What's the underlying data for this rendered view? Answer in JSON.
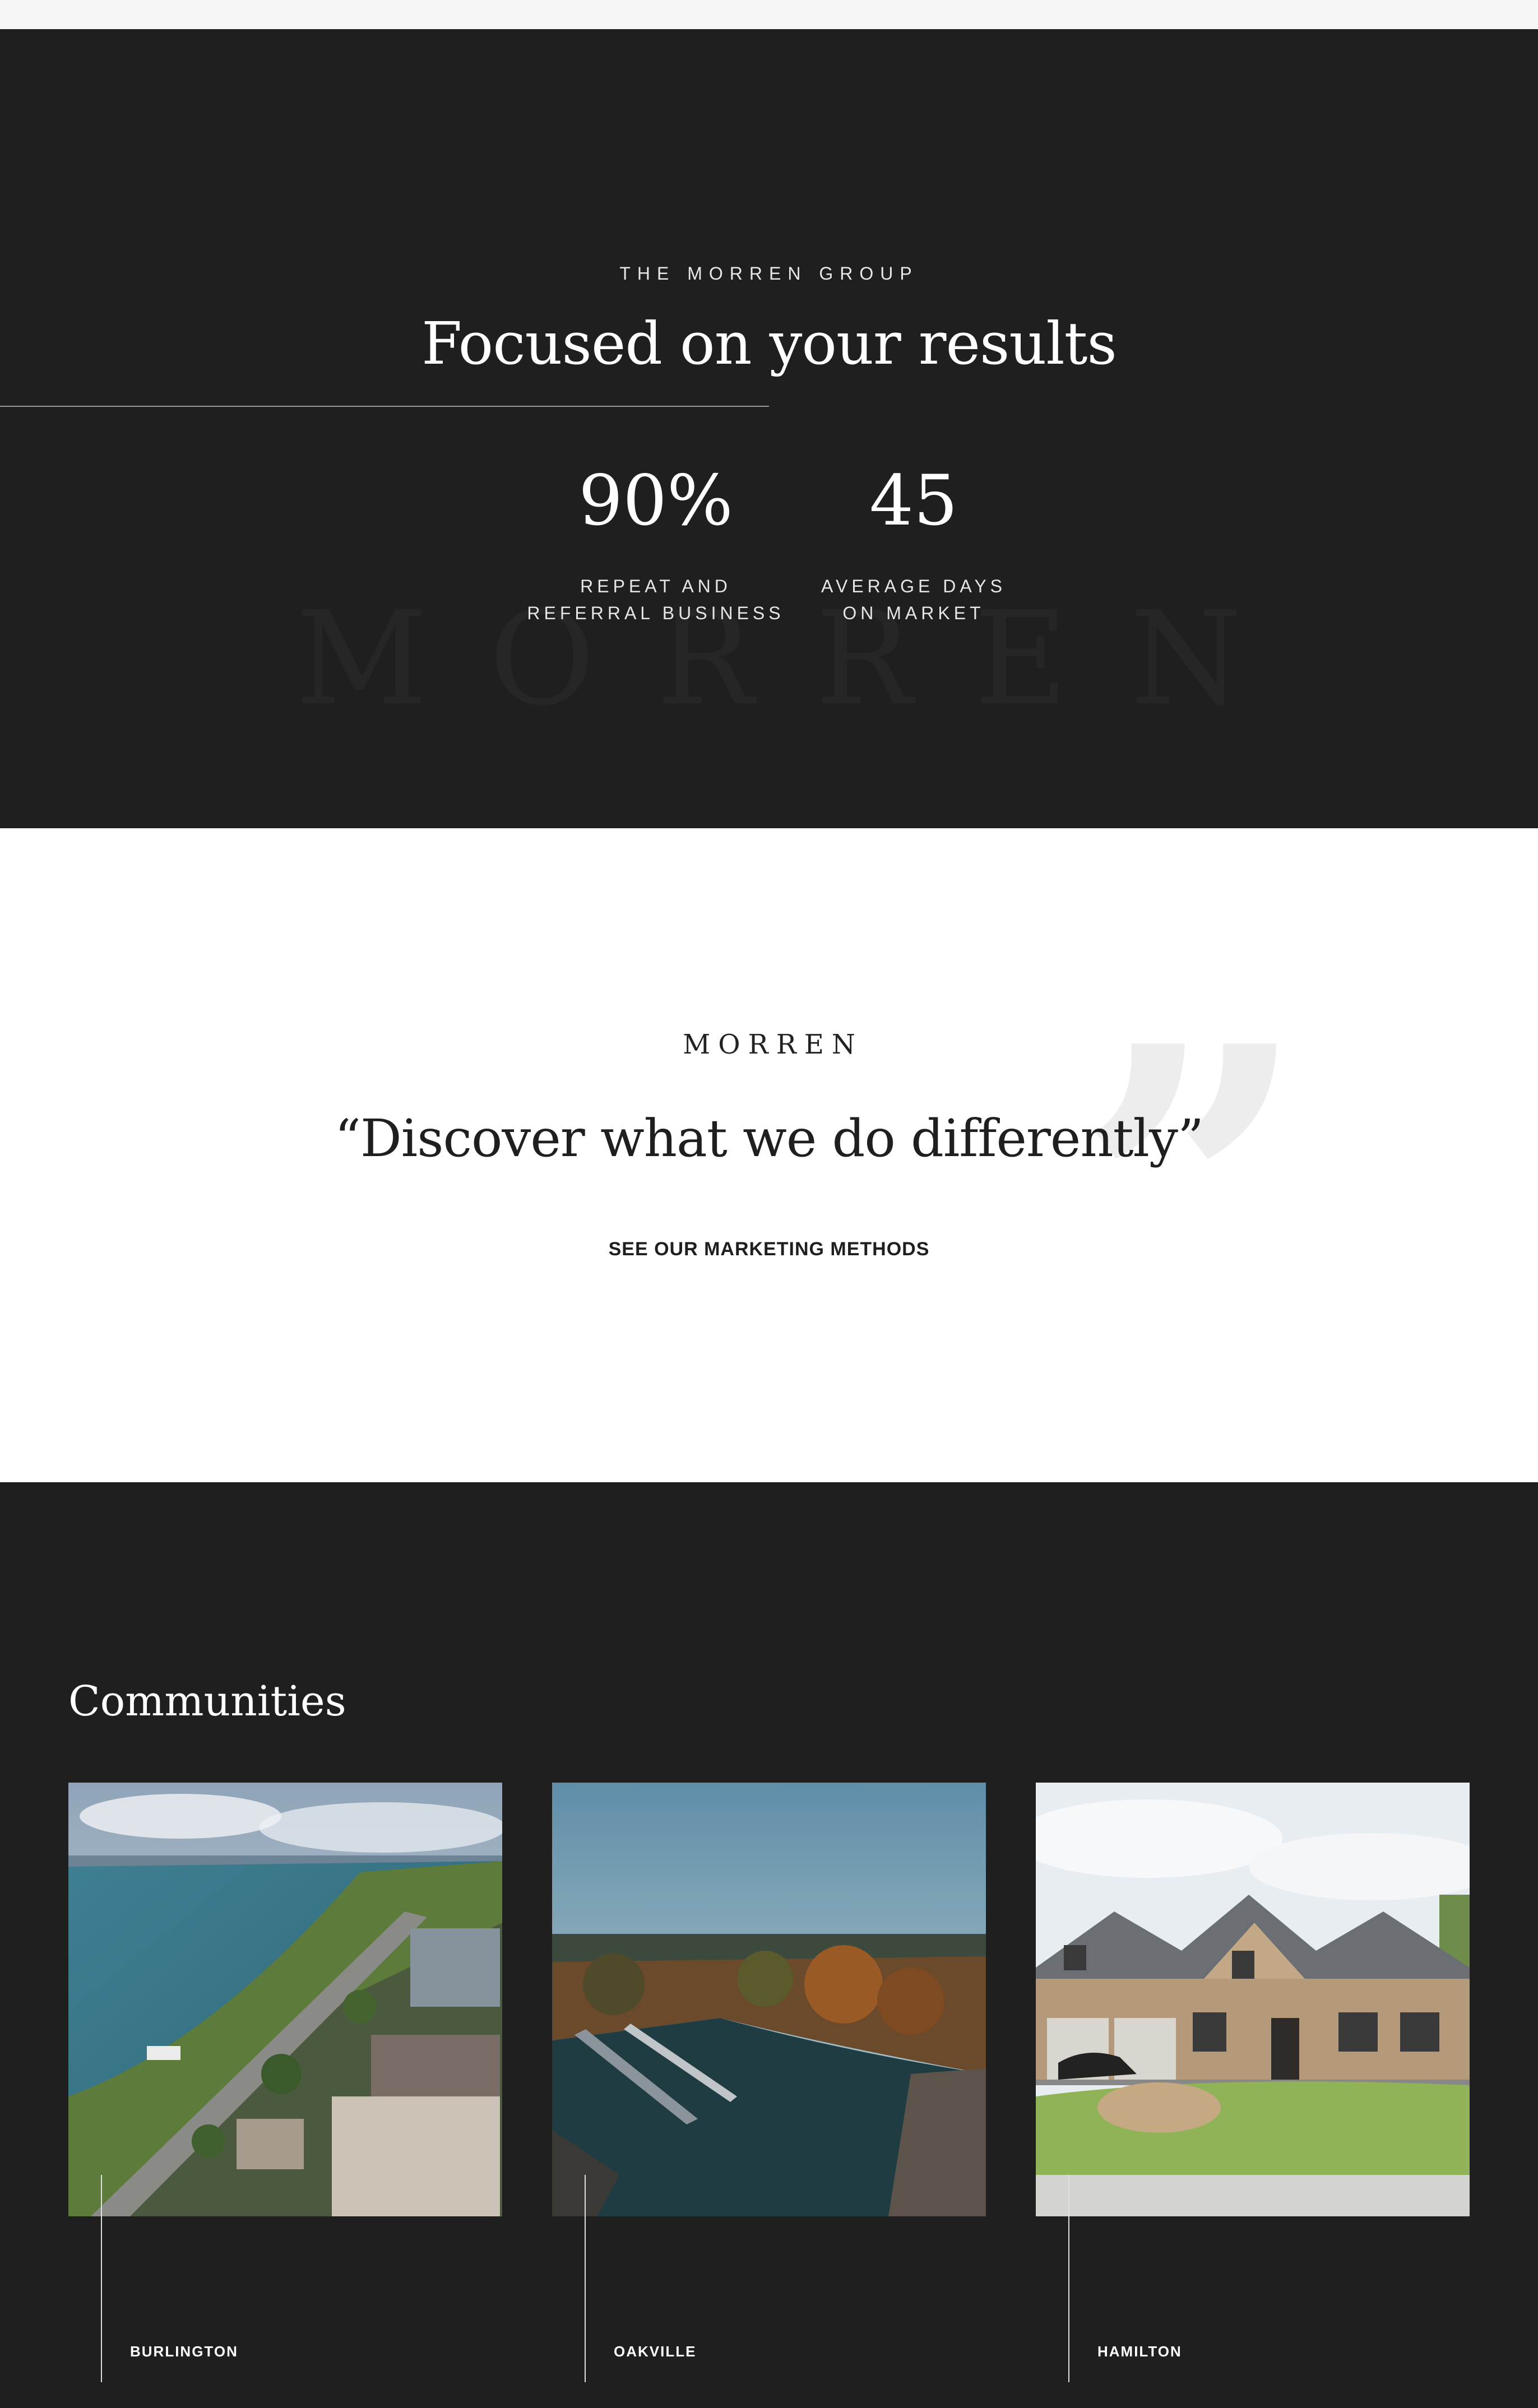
{
  "results": {
    "eyebrow": "THE MORREN GROUP",
    "headline": "Focused on your results",
    "watermark": "MORREN",
    "stats": [
      {
        "value": "90%",
        "label": "REPEAT AND\nREFERRAL BUSINESS"
      },
      {
        "value": "45",
        "label": "AVERAGE DAYS\nON MARKET"
      }
    ]
  },
  "quote": {
    "brand": "MORREN",
    "text": "“Discover what we do differently”",
    "cta": "SEE OUR MARKETING METHODS"
  },
  "communities": {
    "title": "Communities",
    "cards": [
      {
        "name": "BURLINGTON",
        "image": "aerial-lakeshore-photo"
      },
      {
        "name": "OAKVILLE",
        "image": "harbour-marina-photo"
      },
      {
        "name": "HAMILTON",
        "image": "stone-house-photo"
      }
    ]
  },
  "colors": {
    "dark_bg": "#1f1f1f",
    "light_bg": "#ffffff",
    "text_light": "#ffffff",
    "text_dark": "#1f1f1f"
  }
}
